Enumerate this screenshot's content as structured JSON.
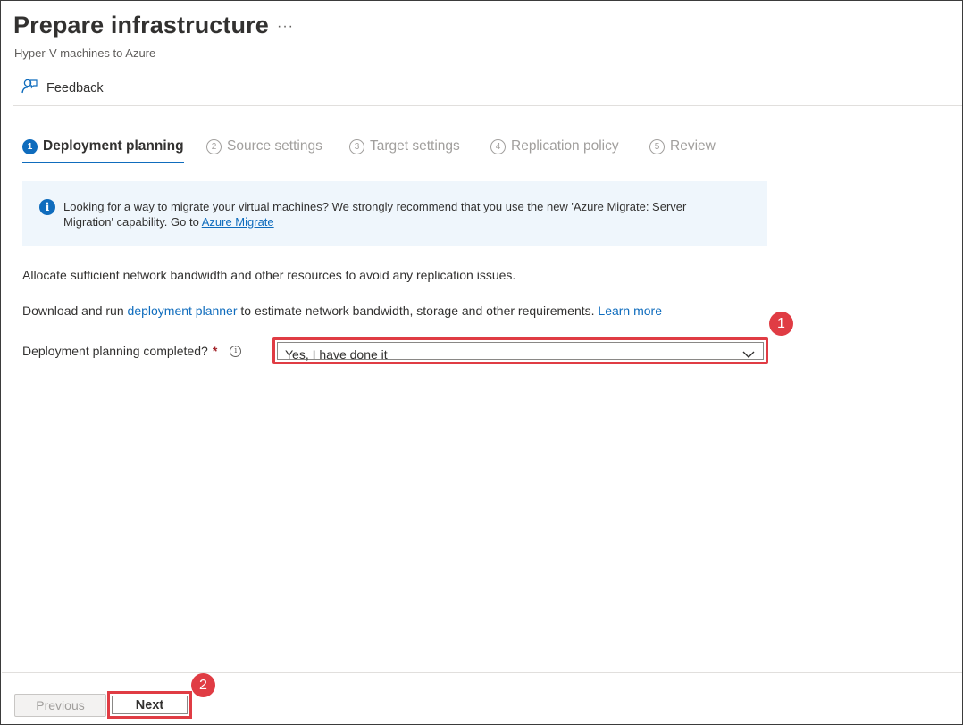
{
  "header": {
    "title": "Prepare infrastructure",
    "subtitle": "Hyper-V machines to Azure",
    "more_label": "···"
  },
  "toolbar": {
    "feedback_label": "Feedback",
    "feedback_icon": "feedback-person-icon"
  },
  "steps": [
    {
      "number": "1",
      "label": "Deployment planning",
      "active": true
    },
    {
      "number": "2",
      "label": "Source settings",
      "active": false
    },
    {
      "number": "3",
      "label": "Target settings",
      "active": false
    },
    {
      "number": "4",
      "label": "Replication policy",
      "active": false
    },
    {
      "number": "5",
      "label": "Review",
      "active": false
    }
  ],
  "info_banner": {
    "icon": "info-icon",
    "text_line1": "Looking for a way to migrate your virtual machines? We strongly recommend that you use the new 'Azure Migrate: Server",
    "text_line2_prefix": "Migration' capability. Go to ",
    "link_text": "Azure Migrate"
  },
  "content": {
    "paragraph1": "Allocate sufficient network bandwidth and other resources to avoid any replication issues.",
    "paragraph2_prefix": "Download and run ",
    "paragraph2_link": "deployment planner",
    "paragraph2_suffix": " to estimate network bandwidth, storage and other requirements. ",
    "learn_more": "Learn more"
  },
  "field": {
    "label": "Deployment planning completed?",
    "required_mark": "*",
    "info_icon_glyph": "i",
    "selected_value": "Yes, I have done it"
  },
  "annotations": {
    "badge1": "1",
    "badge2": "2",
    "color": "#e03c44"
  },
  "footer": {
    "previous_label": "Previous",
    "next_label": "Next"
  },
  "colors": {
    "accent": "#0f6cbd",
    "banner_bg": "#eff6fc",
    "highlight": "#e03c44"
  }
}
